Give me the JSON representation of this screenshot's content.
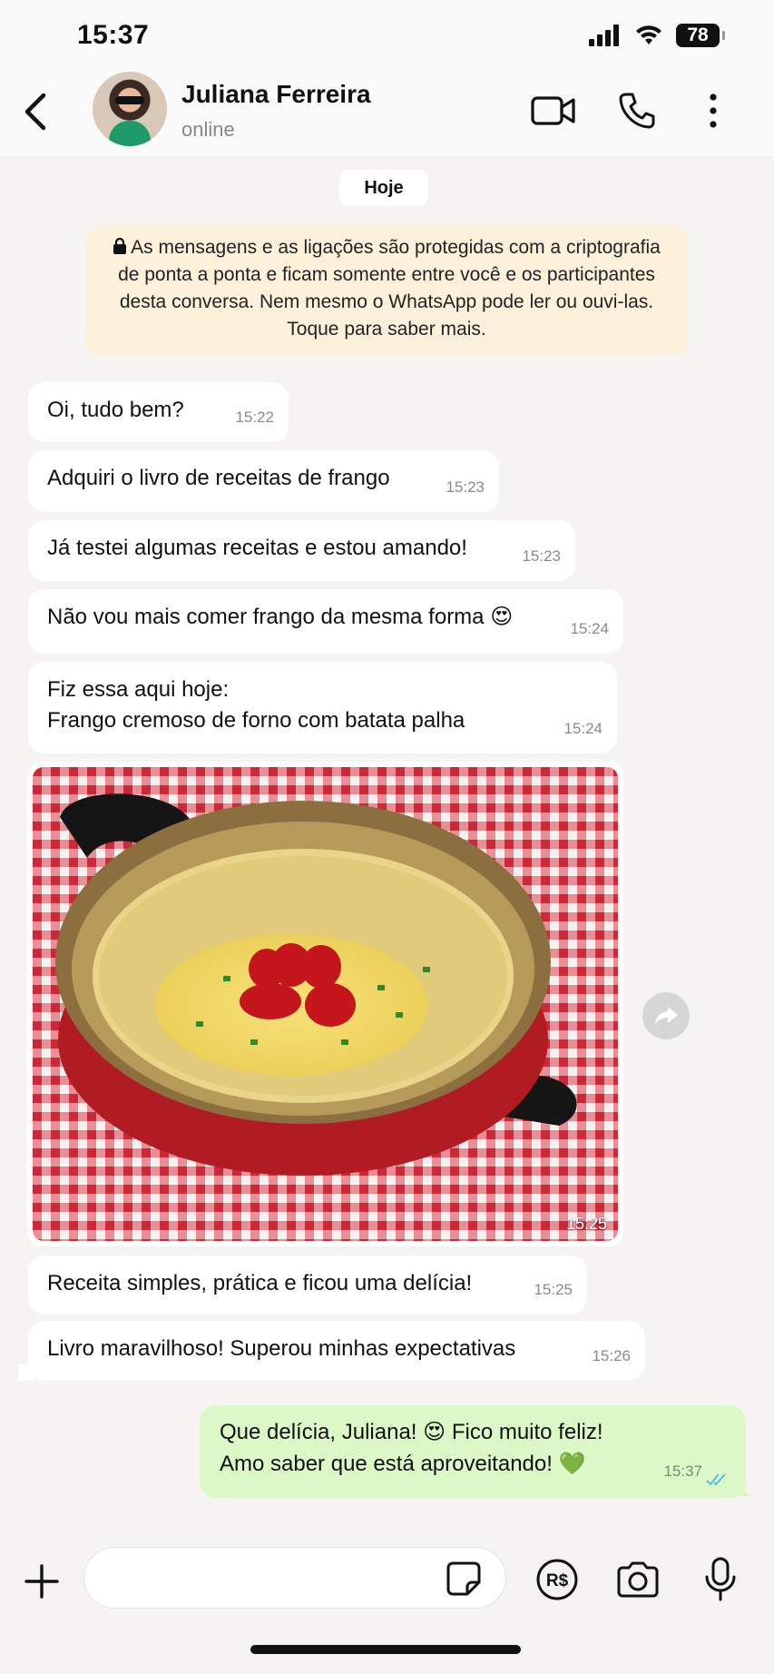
{
  "status_bar": {
    "time": "15:37",
    "battery": "78"
  },
  "header": {
    "contact_name": "Juliana Ferreira",
    "contact_status": "online"
  },
  "date_chip": "Hoje",
  "encryption_notice": "As mensagens e as ligações são protegidas com a criptografia de ponta a ponta e ficam somente entre você e os participantes desta conversa. Nem mesmo o WhatsApp pode ler ou ouvi-las. Toque para saber mais.",
  "messages": [
    {
      "text": "Oi, tudo bem?",
      "time": "15:22"
    },
    {
      "text": "Adquiri o livro de receitas de frango",
      "time": "15:23"
    },
    {
      "text": "Já testei algumas receitas e estou amando!",
      "time": "15:23"
    },
    {
      "text": "Não vou mais comer frango da mesma forma 😍",
      "time": "15:24"
    },
    {
      "text": "Fiz essa aqui hoje:\nFrango cremoso de forno com batata palha",
      "time": "15:24"
    },
    {
      "image_description": "frango-cremoso-photo",
      "time": "15:25"
    },
    {
      "text": "Receita simples, prática e ficou uma delícia!",
      "time": "15:25"
    },
    {
      "text": "Livro maravilhoso! Superou minhas expectativas",
      "time": "15:26"
    }
  ],
  "outgoing": {
    "text": "Que delícia, Juliana! 😍 Fico muito feliz!\nAmo saber que está aproveitando! 💚",
    "time": "15:37",
    "status": "read"
  },
  "input": {
    "placeholder": ""
  },
  "icons": {
    "back": "chevron-left-icon",
    "video": "video-call-icon",
    "phone": "phone-icon",
    "menu": "more-vertical-icon",
    "lock": "lock-icon",
    "forward": "forward-icon",
    "plus": "plus-icon",
    "sticker": "sticker-icon",
    "payment": "payment-icon",
    "camera": "camera-icon",
    "mic": "microphone-icon"
  },
  "colors": {
    "outgoing_bubble": "#dcf8c6",
    "notice_bg": "#fdf1dc",
    "read_ticks": "#53bdeb"
  }
}
